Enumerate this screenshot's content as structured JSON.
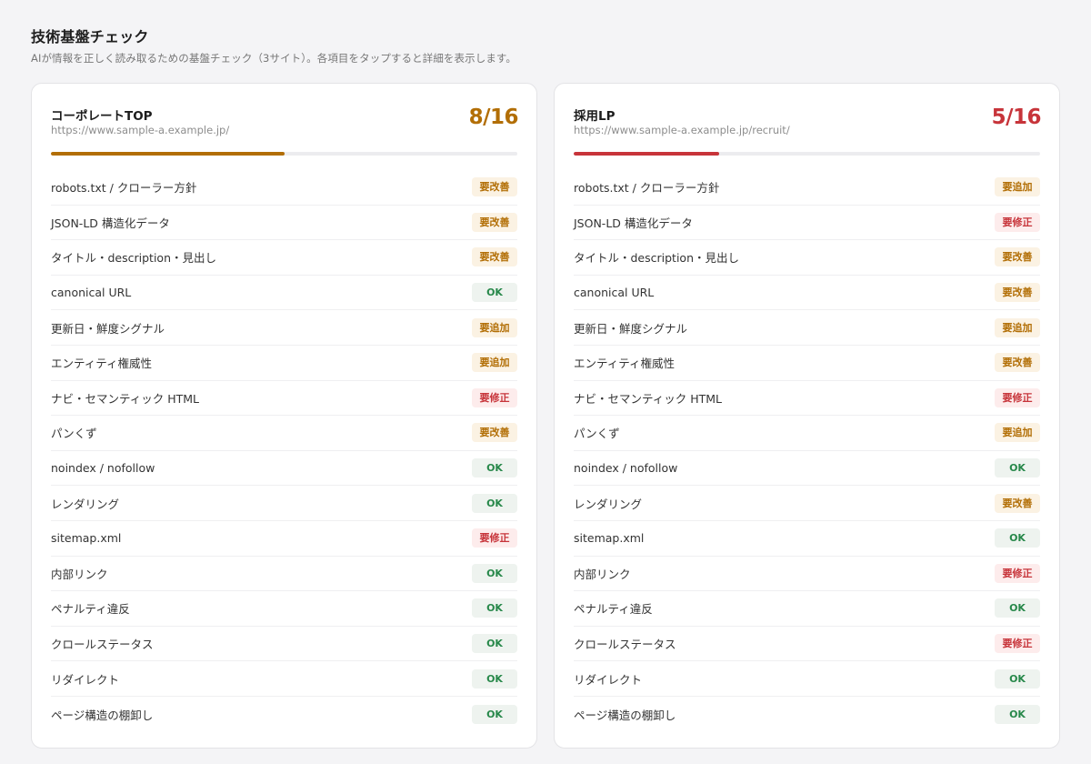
{
  "header": {
    "title": "技術基盤チェック",
    "subtitle": "AIが情報を正しく読み取るための基盤チェック（3サイト）。各項目をタップすると詳細を表示します。"
  },
  "status_colors": {
    "ok": "#27884a",
    "improve": "#b26e05",
    "add": "#b26e05",
    "fix": "#c7343a"
  },
  "sites": [
    {
      "name": "コーポレートTOP",
      "url": "https://www.sample-a.example.jp/",
      "score": "8/16",
      "score_color": "#b26e05",
      "progress": 0.5,
      "items": [
        {
          "label": "robots.txt / クローラー方針",
          "status": "要改善",
          "kind": "improve"
        },
        {
          "label": "JSON-LD 構造化データ",
          "status": "要改善",
          "kind": "improve"
        },
        {
          "label": "タイトル・description・見出し",
          "status": "要改善",
          "kind": "improve"
        },
        {
          "label": "canonical URL",
          "status": "OK",
          "kind": "ok"
        },
        {
          "label": "更新日・鮮度シグナル",
          "status": "要追加",
          "kind": "add"
        },
        {
          "label": "エンティティ権威性",
          "status": "要追加",
          "kind": "add"
        },
        {
          "label": "ナビ・セマンティック HTML",
          "status": "要修正",
          "kind": "fix"
        },
        {
          "label": "パンくず",
          "status": "要改善",
          "kind": "improve"
        },
        {
          "label": "noindex / nofollow",
          "status": "OK",
          "kind": "ok"
        },
        {
          "label": "レンダリング",
          "status": "OK",
          "kind": "ok"
        },
        {
          "label": "sitemap.xml",
          "status": "要修正",
          "kind": "fix"
        },
        {
          "label": "内部リンク",
          "status": "OK",
          "kind": "ok"
        },
        {
          "label": "ペナルティ違反",
          "status": "OK",
          "kind": "ok"
        },
        {
          "label": "クロールステータス",
          "status": "OK",
          "kind": "ok"
        },
        {
          "label": "リダイレクト",
          "status": "OK",
          "kind": "ok"
        },
        {
          "label": "ページ構造の棚卸し",
          "status": "OK",
          "kind": "ok"
        }
      ]
    },
    {
      "name": "採用LP",
      "url": "https://www.sample-a.example.jp/recruit/",
      "score": "5/16",
      "score_color": "#c7343a",
      "progress": 0.3125,
      "items": [
        {
          "label": "robots.txt / クローラー方針",
          "status": "要追加",
          "kind": "add"
        },
        {
          "label": "JSON-LD 構造化データ",
          "status": "要修正",
          "kind": "fix"
        },
        {
          "label": "タイトル・description・見出し",
          "status": "要改善",
          "kind": "improve"
        },
        {
          "label": "canonical URL",
          "status": "要改善",
          "kind": "improve"
        },
        {
          "label": "更新日・鮮度シグナル",
          "status": "要追加",
          "kind": "add"
        },
        {
          "label": "エンティティ権威性",
          "status": "要改善",
          "kind": "improve"
        },
        {
          "label": "ナビ・セマンティック HTML",
          "status": "要修正",
          "kind": "fix"
        },
        {
          "label": "パンくず",
          "status": "要追加",
          "kind": "add"
        },
        {
          "label": "noindex / nofollow",
          "status": "OK",
          "kind": "ok"
        },
        {
          "label": "レンダリング",
          "status": "要改善",
          "kind": "improve"
        },
        {
          "label": "sitemap.xml",
          "status": "OK",
          "kind": "ok"
        },
        {
          "label": "内部リンク",
          "status": "要修正",
          "kind": "fix"
        },
        {
          "label": "ペナルティ違反",
          "status": "OK",
          "kind": "ok"
        },
        {
          "label": "クロールステータス",
          "status": "要修正",
          "kind": "fix"
        },
        {
          "label": "リダイレクト",
          "status": "OK",
          "kind": "ok"
        },
        {
          "label": "ページ構造の棚卸し",
          "status": "OK",
          "kind": "ok"
        }
      ]
    }
  ]
}
